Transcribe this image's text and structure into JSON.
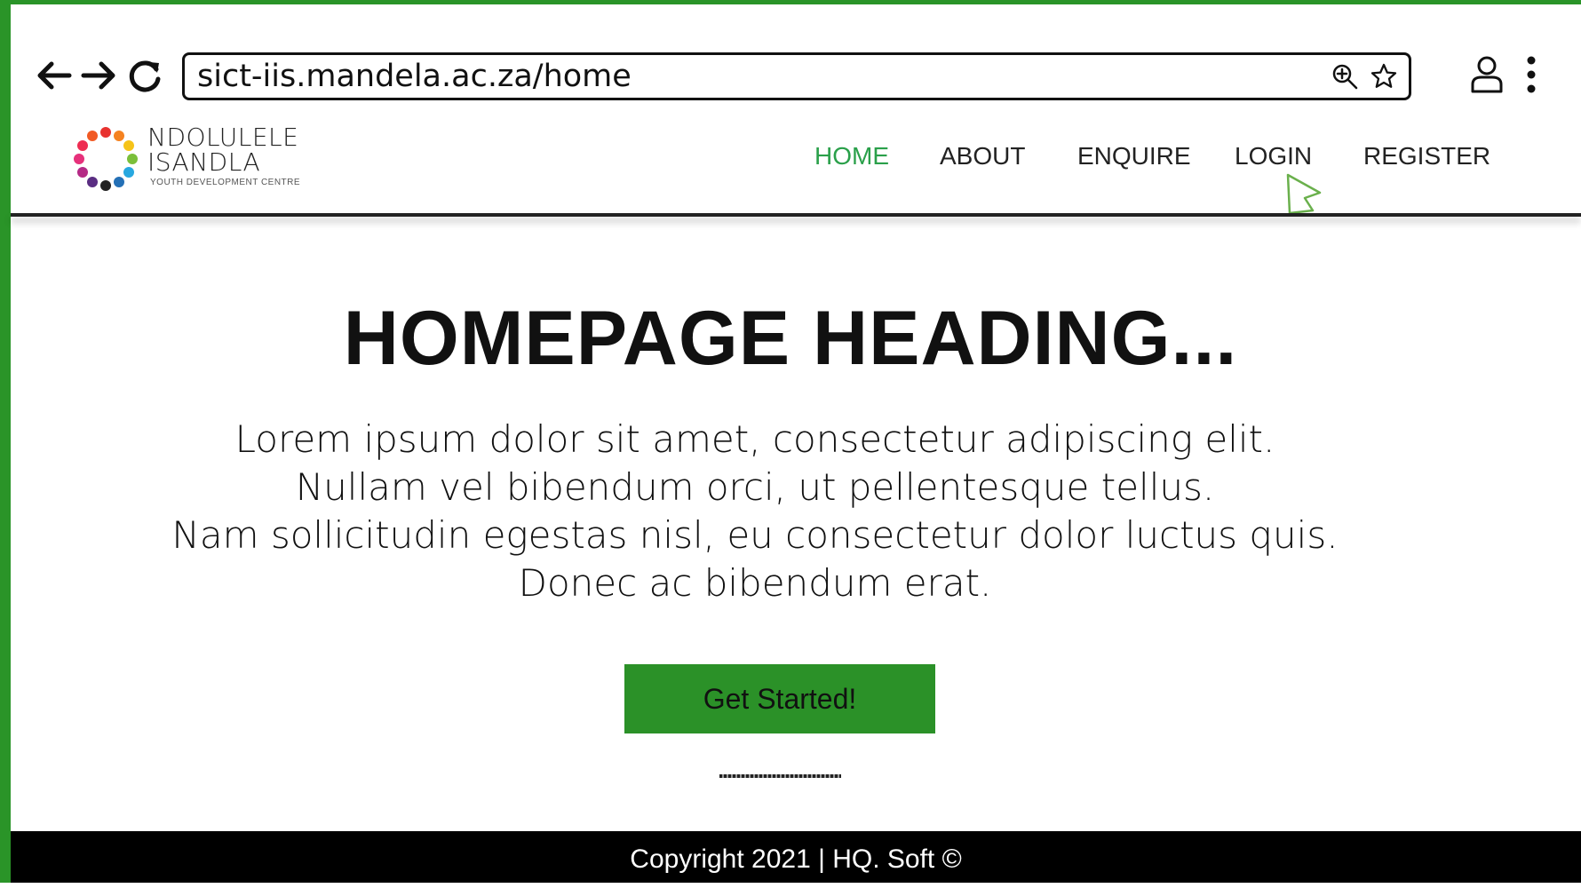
{
  "browser": {
    "url": "sict-iis.mandela.ac.za/home"
  },
  "site": {
    "brand_line1": "NDOLULELE",
    "brand_line2": "ISANDLA",
    "brand_tagline": "YOUTH DEVELOPMENT CENTRE",
    "nav": [
      {
        "label": "HOME",
        "active": true
      },
      {
        "label": "ABOUT",
        "active": false
      },
      {
        "label": "ENQUIRE",
        "active": false
      },
      {
        "label": "LOGIN",
        "active": false
      },
      {
        "label": "REGISTER",
        "active": false
      }
    ]
  },
  "hero": {
    "heading": "HOMEPAGE HEADING...",
    "lines": [
      "Lorem ipsum dolor sit amet, consectetur adipiscing elit.",
      "Nullam vel bibendum orci, ut pellentesque tellus.",
      "Nam sollicitudin egestas nisl, eu consectetur dolor luctus quis.",
      "Donec ac bibendum erat."
    ],
    "cta_label": "Get Started!"
  },
  "footer": {
    "text": "Copyright 2021 | HQ. Soft ©"
  },
  "colors": {
    "frame": "#2a9428",
    "active_nav": "#2aa04a",
    "cta_bg": "#2b9128",
    "footer_bg": "#000000"
  },
  "icons": {
    "back": "arrow-left-icon",
    "forward": "arrow-right-icon",
    "reload": "reload-icon",
    "zoom": "zoom-in-icon",
    "bookmark": "star-icon",
    "profile": "user-icon",
    "menu": "kebab-menu-icon",
    "logo": "flower-logo-icon",
    "pointer": "mouse-pointer-icon"
  }
}
